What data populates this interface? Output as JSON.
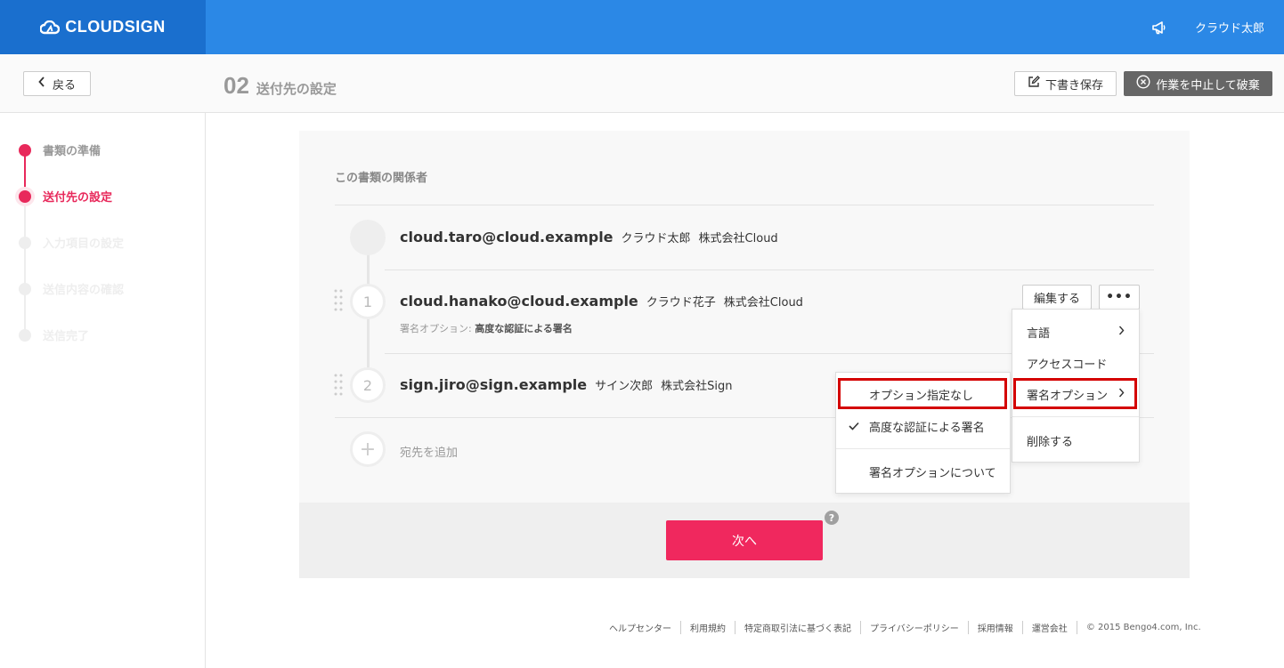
{
  "header": {
    "logo": "CLOUDSIGN",
    "user_name": "クラウド太郎"
  },
  "subheader": {
    "back_label": "戻る",
    "step_number": "02",
    "step_title": "送付先の設定",
    "draft_label": "下書き保存",
    "discard_label": "作業を中止して破棄"
  },
  "sidebar": {
    "steps": [
      {
        "label": "書類の準備",
        "state": "done"
      },
      {
        "label": "送付先の設定",
        "state": "active"
      },
      {
        "label": "入力項目の設定",
        "state": "todo"
      },
      {
        "label": "送信内容の確認",
        "state": "todo"
      },
      {
        "label": "送信完了",
        "state": "todo"
      }
    ]
  },
  "main": {
    "section_title": "この書類の関係者",
    "sender": {
      "email": "cloud.taro@cloud.example",
      "name": "クラウド太郎",
      "company": "株式会社Cloud"
    },
    "recipients": [
      {
        "order": "1",
        "email": "cloud.hanako@cloud.example",
        "name": "クラウド花子",
        "company": "株式会社Cloud",
        "sig_option_label": "署名オプション:",
        "sig_option_value": "高度な認証による署名"
      },
      {
        "order": "2",
        "email": "sign.jiro@sign.example",
        "name": "サイン次郎",
        "company": "株式会社Sign"
      }
    ],
    "add_recipient_label": "宛先を追加",
    "edit_label": "編集する",
    "more_label": "•••",
    "next_label": "次へ",
    "help_label": "?"
  },
  "context_menu": {
    "items": [
      {
        "label": "言語",
        "has_submenu": true
      },
      {
        "label": "アクセスコード",
        "has_submenu": false
      },
      {
        "label": "署名オプション",
        "has_submenu": true,
        "highlighted": true
      },
      {
        "label": "削除する",
        "has_submenu": false
      }
    ]
  },
  "submenu": {
    "items": [
      {
        "label": "オプション指定なし",
        "checked": false,
        "highlighted": true
      },
      {
        "label": "高度な認証による署名",
        "checked": true
      },
      {
        "label": "署名オプションについて",
        "checked": false
      }
    ]
  },
  "footer": {
    "links": [
      "ヘルプセンター",
      "利用規約",
      "特定商取引法に基づく表記",
      "プライバシーポリシー",
      "採用情報",
      "運営会社"
    ],
    "copyright": "© 2015 Bengo4.com, Inc."
  },
  "colors": {
    "header_blue": "#2b88e6",
    "logo_blue": "#1a6fce",
    "accent_pink": "#e8295b",
    "next_button": "#f0285e",
    "highlight_red": "#d40000"
  }
}
